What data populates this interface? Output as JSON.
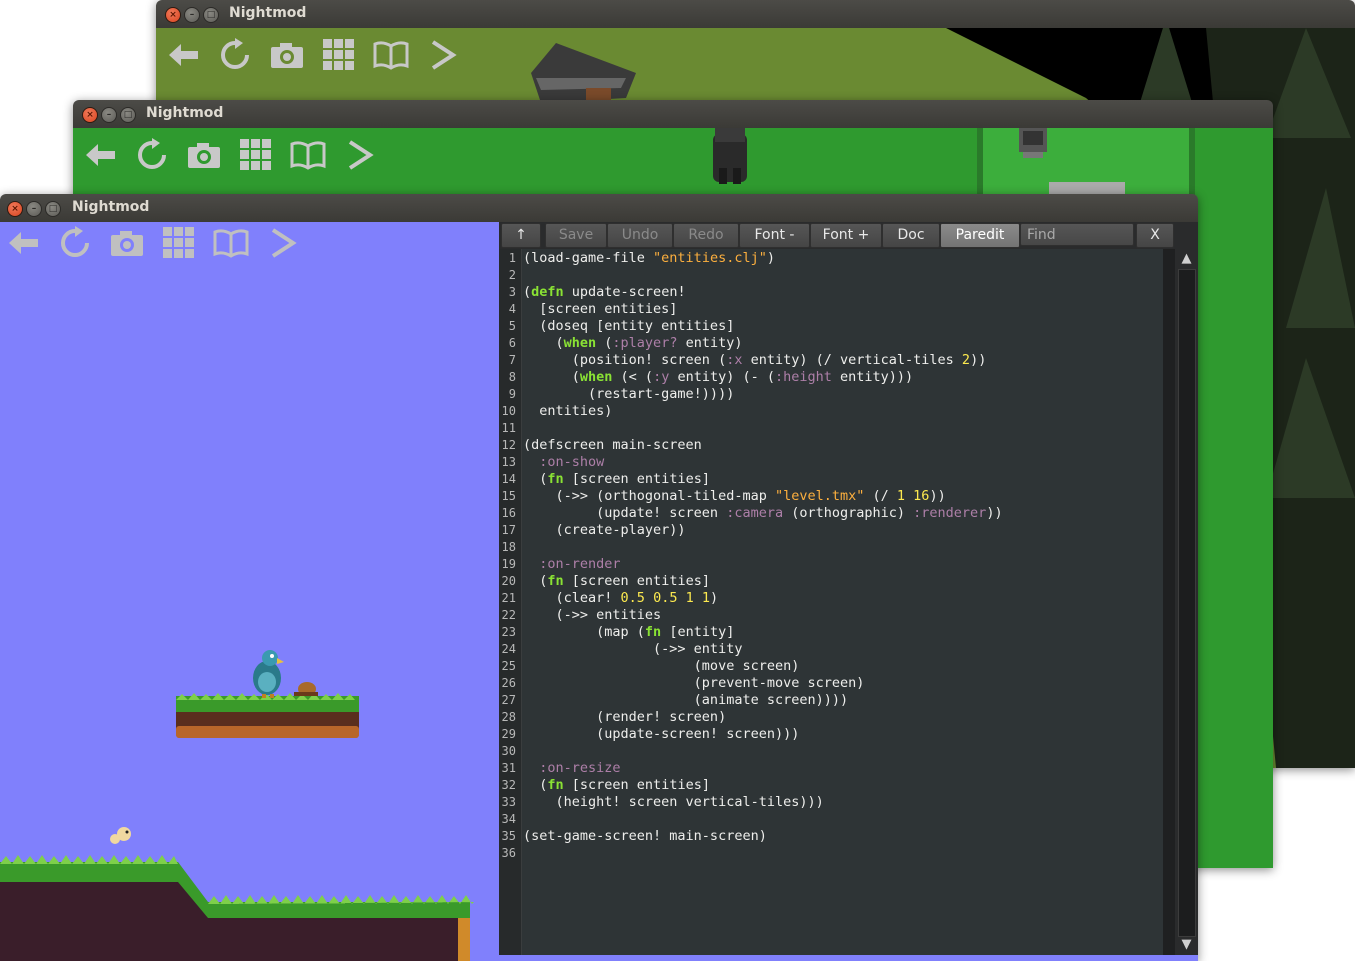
{
  "windows": [
    {
      "id": "back",
      "title": "Nightmod"
    },
    {
      "id": "middle",
      "title": "Nightmod"
    },
    {
      "id": "front",
      "title": "Nightmod"
    }
  ],
  "game_toolbar": {
    "icons": [
      "back-arrow-icon",
      "reload-icon",
      "camera-icon",
      "grid-icon",
      "book-icon",
      "chevron-right-icon"
    ]
  },
  "editor": {
    "toolbar": {
      "up": "↑",
      "save": "Save",
      "undo": "Undo",
      "redo": "Redo",
      "font_minus": "Font -",
      "font_plus": "Font +",
      "doc": "Doc",
      "paredit": "Paredit",
      "find_placeholder": "Find",
      "close": "X"
    },
    "active_button": "Paredit",
    "disabled_buttons": [
      "Save",
      "Undo",
      "Redo"
    ],
    "line_numbers": [
      "1",
      "2",
      "3",
      "4",
      "5",
      "6",
      "7",
      "8",
      "9",
      "10",
      "11",
      "12",
      "13",
      "14",
      "15",
      "16",
      "17",
      "18",
      "19",
      "20",
      "21",
      "22",
      "23",
      "24",
      "25",
      "26",
      "27",
      "28",
      "29",
      "30",
      "31",
      "32",
      "33",
      "34",
      "35",
      "36"
    ],
    "code_lines": [
      [
        [
          "p",
          "(load-game-file "
        ],
        [
          "s",
          "\"entities.clj\""
        ],
        [
          "p",
          ")"
        ]
      ],
      [],
      [
        [
          "p",
          "("
        ],
        [
          "k",
          "defn"
        ],
        [
          "p",
          " update-screen!"
        ]
      ],
      [
        [
          "p",
          "  [screen entities]"
        ]
      ],
      [
        [
          "p",
          "  (doseq [entity entities]"
        ]
      ],
      [
        [
          "p",
          "    ("
        ],
        [
          "k",
          "when"
        ],
        [
          "p",
          " ("
        ],
        [
          "y",
          ":player?"
        ],
        [
          "p",
          " entity)"
        ]
      ],
      [
        [
          "p",
          "      (position! screen ("
        ],
        [
          "y",
          ":x"
        ],
        [
          "p",
          " entity) (/ vertical-tiles "
        ],
        [
          "n",
          "2"
        ],
        [
          "p",
          "))"
        ]
      ],
      [
        [
          "p",
          "      ("
        ],
        [
          "k",
          "when"
        ],
        [
          "p",
          " (< ("
        ],
        [
          "y",
          ":y"
        ],
        [
          "p",
          " entity) (- ("
        ],
        [
          "y",
          ":height"
        ],
        [
          "p",
          " entity)))"
        ]
      ],
      [
        [
          "p",
          "        (restart-game!))))"
        ]
      ],
      [
        [
          "p",
          "  entities)"
        ]
      ],
      [],
      [
        [
          "p",
          "(defscreen main-screen"
        ]
      ],
      [
        [
          "p",
          "  "
        ],
        [
          "y",
          ":on-show"
        ]
      ],
      [
        [
          "p",
          "  ("
        ],
        [
          "k",
          "fn"
        ],
        [
          "p",
          " [screen entities]"
        ]
      ],
      [
        [
          "p",
          "    (->> (orthogonal-tiled-map "
        ],
        [
          "s",
          "\"level.tmx\""
        ],
        [
          "p",
          " (/ "
        ],
        [
          "n",
          "1"
        ],
        [
          "p",
          " "
        ],
        [
          "n",
          "16"
        ],
        [
          "p",
          "))"
        ]
      ],
      [
        [
          "p",
          "         (update! screen "
        ],
        [
          "y",
          ":camera"
        ],
        [
          "p",
          " (orthographic) "
        ],
        [
          "y",
          ":renderer"
        ],
        [
          "p",
          "))"
        ]
      ],
      [
        [
          "p",
          "    (create-player))"
        ]
      ],
      [],
      [
        [
          "p",
          "  "
        ],
        [
          "y",
          ":on-render"
        ]
      ],
      [
        [
          "p",
          "  ("
        ],
        [
          "k",
          "fn"
        ],
        [
          "p",
          " [screen entities]"
        ]
      ],
      [
        [
          "p",
          "    (clear! "
        ],
        [
          "n",
          "0.5"
        ],
        [
          "p",
          " "
        ],
        [
          "n",
          "0.5"
        ],
        [
          "p",
          " "
        ],
        [
          "n",
          "1"
        ],
        [
          "p",
          " "
        ],
        [
          "n",
          "1"
        ],
        [
          "p",
          ")"
        ]
      ],
      [
        [
          "p",
          "    (->> entities"
        ]
      ],
      [
        [
          "p",
          "         (map ("
        ],
        [
          "k",
          "fn"
        ],
        [
          "p",
          " [entity]"
        ]
      ],
      [
        [
          "p",
          "                (->> entity"
        ]
      ],
      [
        [
          "p",
          "                     (move screen)"
        ]
      ],
      [
        [
          "p",
          "                     (prevent-move screen)"
        ]
      ],
      [
        [
          "p",
          "                     (animate screen))))"
        ]
      ],
      [
        [
          "p",
          "         (render! screen)"
        ]
      ],
      [
        [
          "p",
          "         (update-screen! screen)))"
        ]
      ],
      [],
      [
        [
          "p",
          "  "
        ],
        [
          "y",
          ":on-resize"
        ]
      ],
      [
        [
          "p",
          "  ("
        ],
        [
          "k",
          "fn"
        ],
        [
          "p",
          " [screen entities]"
        ]
      ],
      [
        [
          "p",
          "    (height! screen vertical-tiles)))"
        ]
      ],
      [],
      [
        [
          "p",
          "(set-game-screen! main-screen)"
        ]
      ],
      []
    ]
  },
  "colors": {
    "sky": "#8080fc",
    "grass_green": "#2f9a2f",
    "olive_ground": "#6a8a32",
    "editor_bg": "#2e3436",
    "keyword": "#8ae234",
    "string": "#fcaf3e",
    "number": "#fce94f",
    "keyword_literal": "#ad7fa8"
  }
}
